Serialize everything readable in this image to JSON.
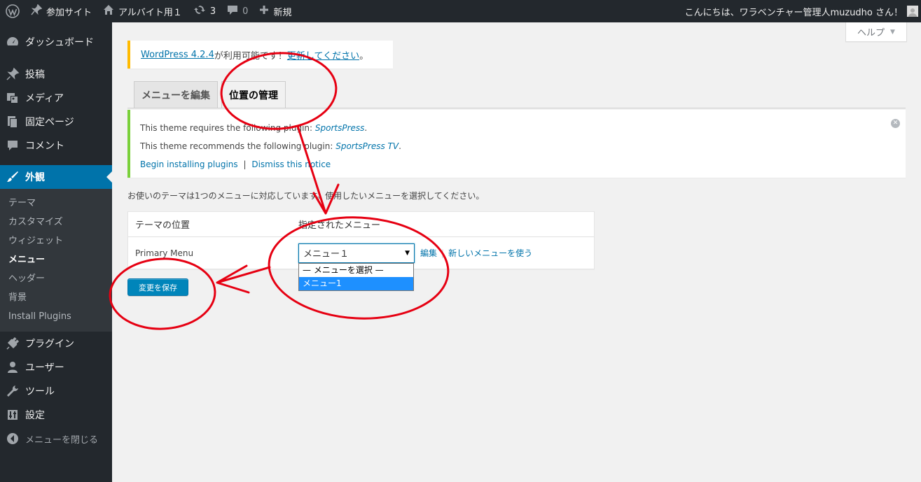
{
  "adminbar": {
    "site_name": "参加サイト",
    "home_label": "アルバイト用１",
    "updates_count": "3",
    "comments_count": "0",
    "new_label": "新規",
    "greeting": "こんにちは、ワラベンチャー管理人muzudho さん！"
  },
  "sidebar": {
    "items": [
      {
        "label": "ダッシュボード"
      },
      {
        "label": "投稿"
      },
      {
        "label": "メディア"
      },
      {
        "label": "固定ページ"
      },
      {
        "label": "コメント"
      },
      {
        "label": "外観"
      },
      {
        "label": "プラグイン"
      },
      {
        "label": "ユーザー"
      },
      {
        "label": "ツール"
      },
      {
        "label": "設定"
      }
    ],
    "submenu": [
      "テーマ",
      "カスタマイズ",
      "ウィジェット",
      "メニュー",
      "ヘッダー",
      "背景",
      "Install Plugins"
    ],
    "collapse_label": "メニューを閉じる"
  },
  "help": {
    "label": "ヘルプ"
  },
  "update_nag": {
    "version_link": "WordPress 4.2.4",
    "middle_text": " が利用可能です！",
    "update_link": "更新してください",
    "tail": "。"
  },
  "tabs": [
    {
      "label": "メニューを編集"
    },
    {
      "label": "位置の管理"
    }
  ],
  "plugin_notice": {
    "requires_prefix": "This theme requires the following plugin: ",
    "requires_plugin": "SportsPress",
    "recommends_prefix": "This theme recommends the following plugin: ",
    "recommends_plugin": "SportsPress TV",
    "period": ".",
    "begin_link": "Begin installing plugins",
    "separator": "|",
    "dismiss_link": "Dismiss this notice"
  },
  "description": "お使いのテーマは1つのメニューに対応しています。使用したいメニューを選択してください。",
  "locations_table": {
    "col_location": "テーマの位置",
    "col_assigned": "指定されたメニュー",
    "row_location": "Primary Menu",
    "selected_menu": "メニュー１",
    "edit_link": "編集",
    "new_menu_link": "新しいメニューを使う"
  },
  "dropdown_options": [
    "— メニューを選択 —",
    "メニュー1"
  ],
  "save_button": "変更を保存",
  "colors": {
    "adminbar_bg": "#23282d",
    "accent": "#0073aa",
    "notice_green": "#7ad03a",
    "nag_yellow": "#ffba00",
    "annotation_red": "#e60012"
  }
}
